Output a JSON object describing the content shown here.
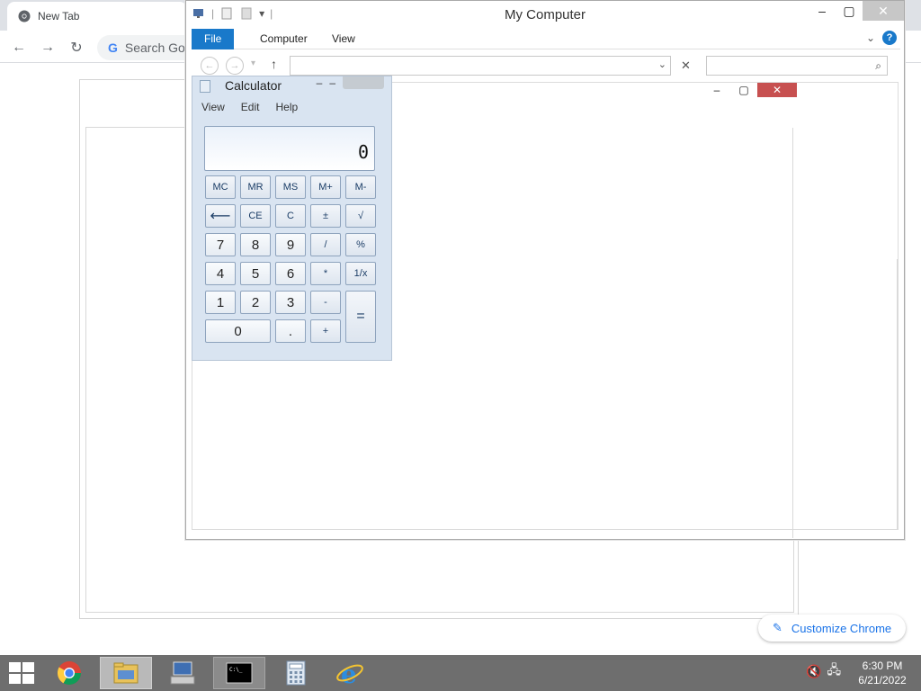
{
  "chrome": {
    "tab_title": "New Tab",
    "omnibox_placeholder": "Search Goo",
    "customize_label": "Customize Chrome"
  },
  "explorer": {
    "title": "My Computer",
    "ribbon_tabs": [
      "File",
      "Computer",
      "View"
    ],
    "address_value": "",
    "search_placeholder": ""
  },
  "calculator": {
    "title": "Calculator",
    "menu": [
      "View",
      "Edit",
      "Help"
    ],
    "display": "0",
    "keys": {
      "mc": "MC",
      "mr": "MR",
      "ms": "MS",
      "mplus": "M+",
      "mminus": "M-",
      "back": "⟵",
      "ce": "CE",
      "c": "C",
      "plusminus": "±",
      "sqrt": "√",
      "k7": "7",
      "k8": "8",
      "k9": "9",
      "div": "/",
      "pct": "%",
      "k4": "4",
      "k5": "5",
      "k6": "6",
      "mul": "*",
      "recip": "1/x",
      "k1": "1",
      "k2": "2",
      "k3": "3",
      "minus": "-",
      "equals": "=",
      "k0": "0",
      "dot": ".",
      "plus": "+"
    }
  },
  "taskbar": {
    "time": "6:30 PM",
    "date": "6/21/2022"
  },
  "colors": {
    "accent_blue": "#1979ca",
    "close_red": "#c75050",
    "taskbar": "#6e6e6e"
  }
}
